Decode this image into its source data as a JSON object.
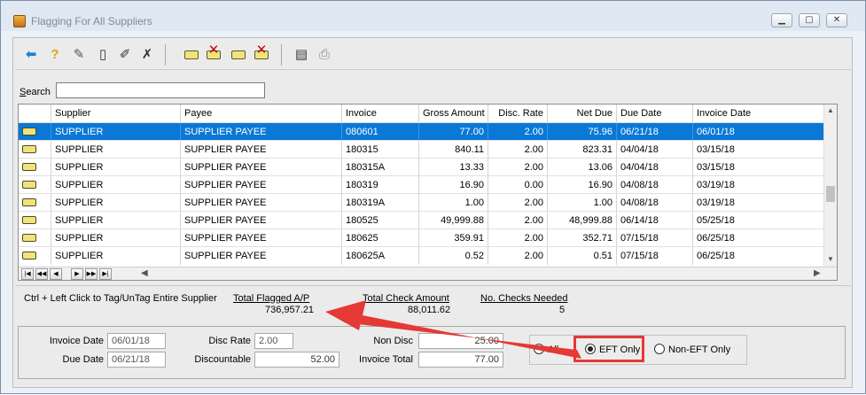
{
  "window": {
    "title": "Flagging For All Suppliers",
    "minimize": "▁",
    "restore": "▢",
    "close": "✕"
  },
  "toolbar": {
    "icons": [
      "back-arrow-icon",
      "help-icon",
      "tools-icon",
      "new-doc-icon",
      "edit-doc-icon",
      "delete-doc-icon",
      "tag-icon",
      "untag-icon",
      "tag-all-icon",
      "untag-all-icon",
      "print-preview-icon",
      "print-icon"
    ]
  },
  "search": {
    "label": "Search",
    "value": ""
  },
  "grid": {
    "columns": [
      "",
      "Supplier",
      "Payee",
      "Invoice",
      "Gross Amount",
      "Disc. Rate",
      "Net Due",
      "Due Date",
      "Invoice Date"
    ],
    "rows": [
      {
        "supplier": "SUPPLIER",
        "payee": "SUPPLIER PAYEE",
        "invoice": "080601",
        "gross": "77.00",
        "disc": "2.00",
        "net": "75.96",
        "due": "06/21/18",
        "inv_date": "06/01/18",
        "selected": true
      },
      {
        "supplier": "SUPPLIER",
        "payee": "SUPPLIER PAYEE",
        "invoice": "180315",
        "gross": "840.11",
        "disc": "2.00",
        "net": "823.31",
        "due": "04/04/18",
        "inv_date": "03/15/18"
      },
      {
        "supplier": "SUPPLIER",
        "payee": "SUPPLIER PAYEE",
        "invoice": "180315A",
        "gross": "13.33",
        "disc": "2.00",
        "net": "13.06",
        "due": "04/04/18",
        "inv_date": "03/15/18"
      },
      {
        "supplier": "SUPPLIER",
        "payee": "SUPPLIER PAYEE",
        "invoice": "180319",
        "gross": "16.90",
        "disc": "0.00",
        "net": "16.90",
        "due": "04/08/18",
        "inv_date": "03/19/18"
      },
      {
        "supplier": "SUPPLIER",
        "payee": "SUPPLIER PAYEE",
        "invoice": "180319A",
        "gross": "1.00",
        "disc": "2.00",
        "net": "1.00",
        "due": "04/08/18",
        "inv_date": "03/19/18"
      },
      {
        "supplier": "SUPPLIER",
        "payee": "SUPPLIER PAYEE",
        "invoice": "180525",
        "gross": "49,999.88",
        "disc": "2.00",
        "net": "48,999.88",
        "due": "06/14/18",
        "inv_date": "05/25/18"
      },
      {
        "supplier": "SUPPLIER",
        "payee": "SUPPLIER PAYEE",
        "invoice": "180625",
        "gross": "359.91",
        "disc": "2.00",
        "net": "352.71",
        "due": "07/15/18",
        "inv_date": "06/25/18"
      },
      {
        "supplier": "SUPPLIER",
        "payee": "SUPPLIER PAYEE",
        "invoice": "180625A",
        "gross": "0.52",
        "disc": "2.00",
        "net": "0.51",
        "due": "07/15/18",
        "inv_date": "06/25/18"
      }
    ],
    "nav_buttons": [
      "|◀",
      "◀◀",
      "◀",
      "▶",
      "▶▶",
      "▶|"
    ]
  },
  "summary": {
    "hint": "Ctrl + Left Click to Tag/UnTag Entire Supplier",
    "total_flagged_label": "Total Flagged A/P",
    "total_flagged_value": "736,957.21",
    "total_check_label": "Total Check Amount",
    "total_check_value": "88,011.62",
    "num_checks_label": "No. Checks Needed",
    "num_checks_value": "5"
  },
  "details": {
    "invoice_date_label": "Invoice Date",
    "invoice_date_value": "06/01/18",
    "due_date_label": "Due Date",
    "due_date_value": "06/21/18",
    "disc_rate_label": "Disc Rate",
    "disc_rate_value": "2.00",
    "discountable_label": "Discountable",
    "discountable_value": "52.00",
    "non_disc_label": "Non Disc",
    "non_disc_value": "25.00",
    "invoice_total_label": "Invoice Total",
    "invoice_total_value": "77.00"
  },
  "filter": {
    "options": [
      "All",
      "EFT Only",
      "Non-EFT Only"
    ],
    "selected": "EFT Only"
  },
  "colors": {
    "selection": "#0a78d7",
    "annotation": "#e53935"
  }
}
